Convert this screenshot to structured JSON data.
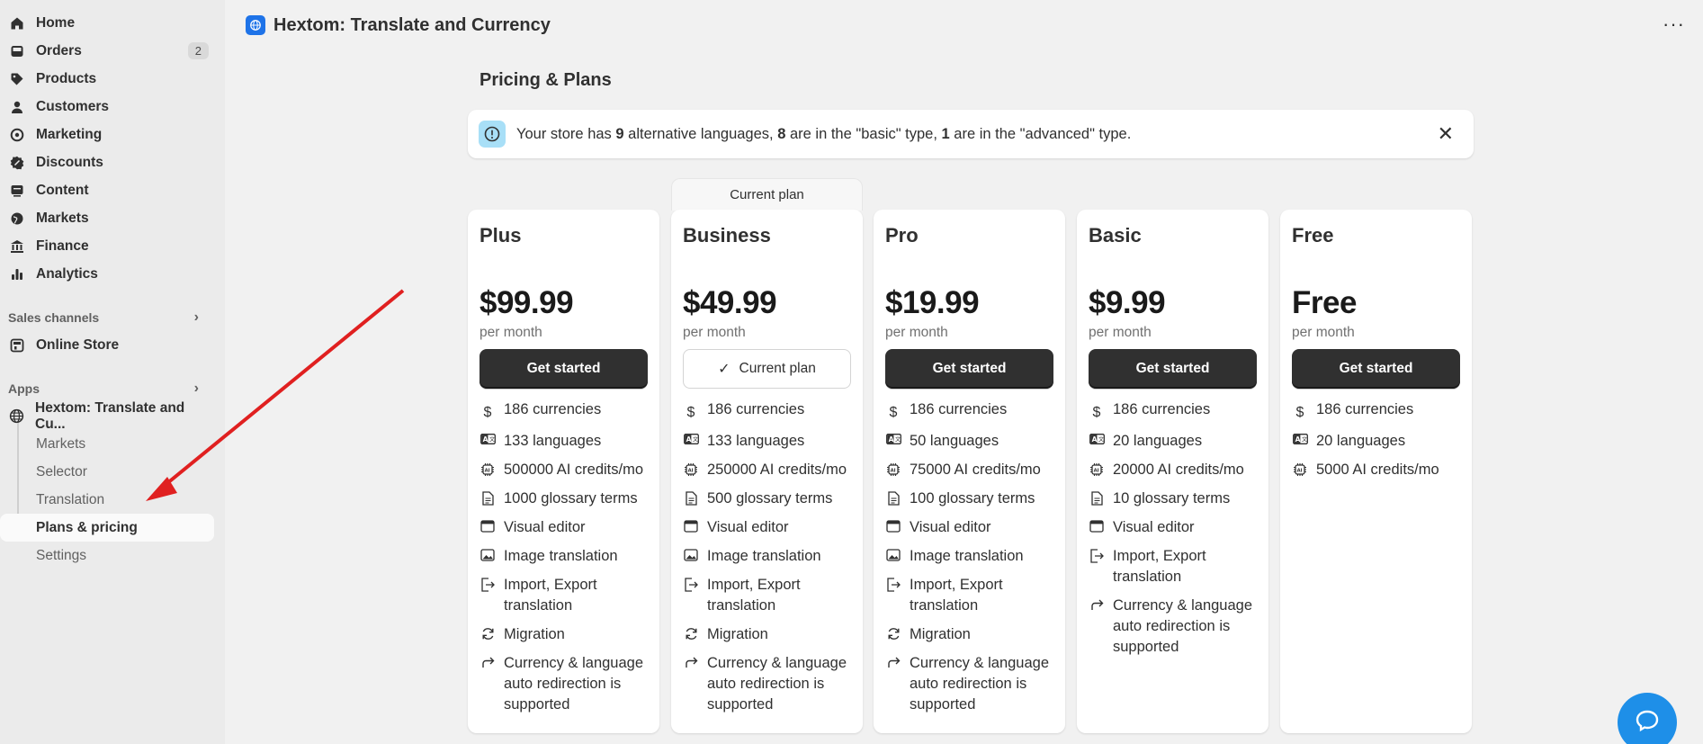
{
  "sidebar": {
    "nav": [
      {
        "label": "Home",
        "icon": "home-icon"
      },
      {
        "label": "Orders",
        "icon": "inbox-icon",
        "badge": "2"
      },
      {
        "label": "Products",
        "icon": "tag-icon"
      },
      {
        "label": "Customers",
        "icon": "person-icon"
      },
      {
        "label": "Marketing",
        "icon": "target-icon"
      },
      {
        "label": "Discounts",
        "icon": "discount-icon"
      },
      {
        "label": "Content",
        "icon": "content-icon"
      },
      {
        "label": "Markets",
        "icon": "globe-icon"
      },
      {
        "label": "Finance",
        "icon": "bank-icon"
      },
      {
        "label": "Analytics",
        "icon": "bar-chart-icon"
      }
    ],
    "sales_channels_label": "Sales channels",
    "online_store_label": "Online Store",
    "apps_label": "Apps",
    "app_name": "Hextom: Translate and Cu...",
    "app_sub_items": [
      "Markets",
      "Selector",
      "Translation",
      "Plans & pricing",
      "Settings"
    ]
  },
  "header": {
    "title": "Hextom: Translate and Currency",
    "more": "···"
  },
  "main": {
    "page_title": "Pricing & Plans",
    "banner": {
      "pre": "Your store has ",
      "count_alt": "9",
      "mid1": " alternative languages, ",
      "count_basic": "8",
      "mid2": " are in the \"basic\" type, ",
      "count_adv": "1",
      "post": " are in the \"advanced\" type."
    },
    "current_plan_tab": "Current plan",
    "plans": [
      {
        "name": "Plus",
        "price": "$99.99",
        "period": "per month",
        "button": "Get started",
        "features": [
          "186 currencies",
          "133 languages",
          "500000 AI credits/mo",
          "1000 glossary terms",
          "Visual editor",
          "Image translation",
          "Import, Export translation",
          "Migration",
          "Currency & language auto redirection is supported"
        ]
      },
      {
        "name": "Business",
        "price": "$49.99",
        "period": "per month",
        "button": "Current plan",
        "features": [
          "186 currencies",
          "133 languages",
          "250000 AI credits/mo",
          "500 glossary terms",
          "Visual editor",
          "Image translation",
          "Import, Export translation",
          "Migration",
          "Currency & language auto redirection is supported"
        ]
      },
      {
        "name": "Pro",
        "price": "$19.99",
        "period": "per month",
        "button": "Get started",
        "features": [
          "186 currencies",
          "50 languages",
          "75000 AI credits/mo",
          "100 glossary terms",
          "Visual editor",
          "Image translation",
          "Import, Export translation",
          "Migration",
          "Currency & language auto redirection is supported"
        ]
      },
      {
        "name": "Basic",
        "price": "$9.99",
        "period": "per month",
        "button": "Get started",
        "features": [
          "186 currencies",
          "20 languages",
          "20000 AI credits/mo",
          "10 glossary terms",
          "Visual editor",
          "Import, Export translation",
          "Currency & language auto redirection is supported"
        ]
      },
      {
        "name": "Free",
        "price": "Free",
        "period": "per month",
        "button": "Get started",
        "features": [
          "186 currencies",
          "20 languages",
          "5000 AI credits/mo"
        ]
      }
    ]
  },
  "colors": {
    "accent": "#1e73e8",
    "button_dark": "#303030",
    "arrow": "#e02020",
    "info": "#a8dff7"
  }
}
